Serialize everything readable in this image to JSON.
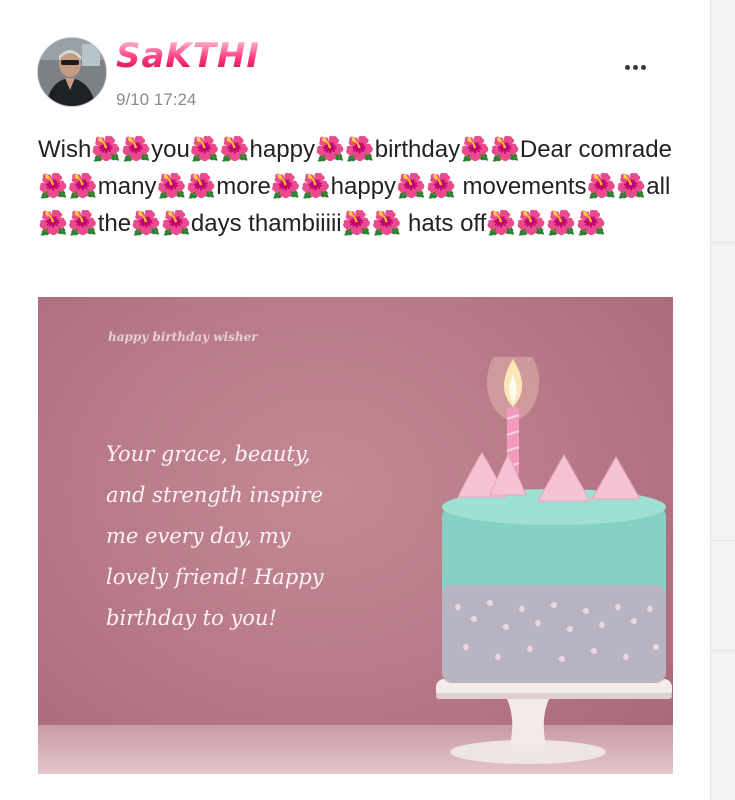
{
  "post": {
    "author_name": "SaKTHI",
    "timestamp": "9/10 17:24",
    "more_menu_icon": "more-horizontal-icon",
    "text": "Wish🌺🌺you🌺🌺happy🌺🌺birthday🌺🌺Dear comrade🌺🌺many🌺🌺more🌺🌺happy🌺🌺 movements🌺🌺all🌺🌺the🌺🌺days thambiiiii🌺🌺 hats off🌺🌺🌺🌺"
  },
  "card": {
    "watermark": "happy birthday wisher",
    "message": "Your grace, beauty,\nand strength inspire\nme every day, my\nlovely friend! Happy\nbirthday to you!"
  },
  "colors": {
    "card_background": "#b97b89",
    "cake_frosting": "#7fcfc0",
    "meringue": "#f5c6d6",
    "timestamp_text": "#8a8a8a"
  }
}
